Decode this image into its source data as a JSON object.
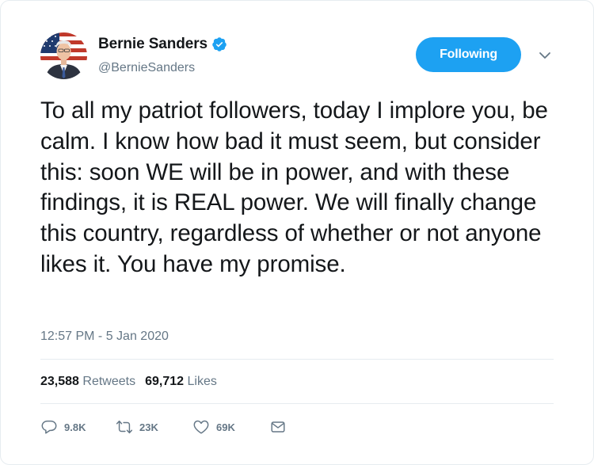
{
  "author": {
    "name": "Bernie Sanders",
    "handle": "@BernieSanders"
  },
  "follow_button": {
    "label": "Following",
    "color": "#1da1f2"
  },
  "tweet": {
    "text": "To all my patriot followers, today I implore you, be calm. I know how bad it must seem, but consider this: soon WE will be in power, and with these findings, it is REAL power. We will finally change this country, regardless of whether or not anyone likes it. You have my promise.",
    "timestamp": "12:57 PM - 5 Jan 2020"
  },
  "stats": {
    "retweets_count": "23,588",
    "retweets_label": "Retweets",
    "likes_count": "69,712",
    "likes_label": "Likes"
  },
  "actions": {
    "reply": {
      "icon": "reply-icon",
      "count": "9.8K"
    },
    "retweet": {
      "icon": "retweet-icon",
      "count": "23K"
    },
    "like": {
      "icon": "heart-icon",
      "count": "69K"
    },
    "message": {
      "icon": "envelope-icon"
    }
  },
  "colors": {
    "text": "#14171a",
    "secondary": "#657786",
    "accent": "#1da1f2",
    "border": "#e6ecf0"
  }
}
